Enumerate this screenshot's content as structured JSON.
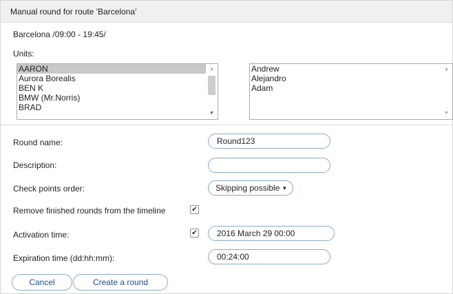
{
  "dialog": {
    "title": "Manual round for route 'Barcelona'",
    "route_info": "Barcelona  /09:00 - 19:45/",
    "units_label": "Units:"
  },
  "units": {
    "available": [
      "AARON",
      "Aurora Borealis",
      "BEN K",
      "BMW (Mr.Norris)",
      "BRAD"
    ],
    "selected_available": "AARON",
    "chosen": [
      "Andrew",
      "Alejandro",
      "Adam"
    ]
  },
  "form": {
    "round_name": {
      "label": "Round name:",
      "value": "Round123"
    },
    "description": {
      "label": "Description:",
      "value": ""
    },
    "checkpoints_order": {
      "label": "Check points order:",
      "value": "Skipping possible"
    },
    "remove_finished": {
      "label": "Remove finished rounds from the timeline",
      "checked": true
    },
    "activation_time": {
      "label": "Activation time:",
      "checked": true,
      "value": "2016 March 29 00:00"
    },
    "expiration_time": {
      "label": "Expiration time (dd:hh:mm):",
      "value": "00:24:00"
    }
  },
  "buttons": {
    "cancel": "Cancel",
    "create": "Create a round"
  },
  "icons": {
    "checkmark": "✔",
    "caret": "▼",
    "scroll_up": "▲",
    "scroll_down": "▼"
  },
  "colors": {
    "accent_border": "#8aa9c6",
    "button_text": "#1f4e8c",
    "title_bg": "#f0f0f0",
    "selected_item_bg": "#c8c8c8"
  }
}
